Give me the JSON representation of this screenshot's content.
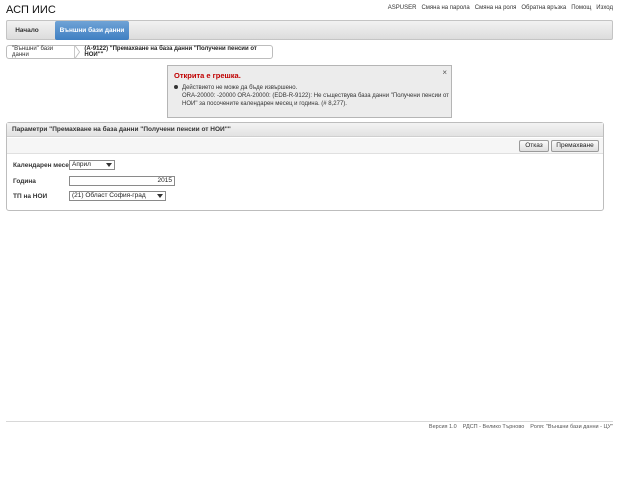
{
  "app": {
    "title": "АСП ИИС"
  },
  "toplinks": [
    "ASPUSER",
    "Смяна на парола",
    "Смяна на роля",
    "Обратна връзка",
    "Помощ",
    "Изход"
  ],
  "nav": {
    "home": "Начало",
    "external": "Външни бази данни"
  },
  "breadcrumb": {
    "parent": "\"Външни\" бази данни",
    "current": "(А-9122) \"Премахване на база данни \"Получени пенсии от НОИ\"\""
  },
  "error": {
    "title": "Открита е грешка.",
    "line1": "Действието не може да бъде извършено.",
    "line2": "ORA-20000: -20000 ORA-20000: (EDB-R-9122): Не съществува база данни \"Получени пенсии от",
    "line3": "НОИ\" за посочените календарен месец и година. (# 8,277).",
    "close": "×"
  },
  "region": {
    "title": "Параметри \"Премахване на база данни \"Получени пенсии от НОИ\"\"",
    "cancel_label": "Отказ",
    "delete_label": "Премахване"
  },
  "form": {
    "month_label": "Календарен месец",
    "month_value": "Април",
    "year_label": "Година",
    "year_value": "2015",
    "tp_label": "ТП на НОИ",
    "tp_value": "(21) Област София-град"
  },
  "footer": {
    "version": "Версия 1.0",
    "office": "РДСП - Велико Търново",
    "role": "Роля: \"Външни бази данни - ЦУ\""
  }
}
